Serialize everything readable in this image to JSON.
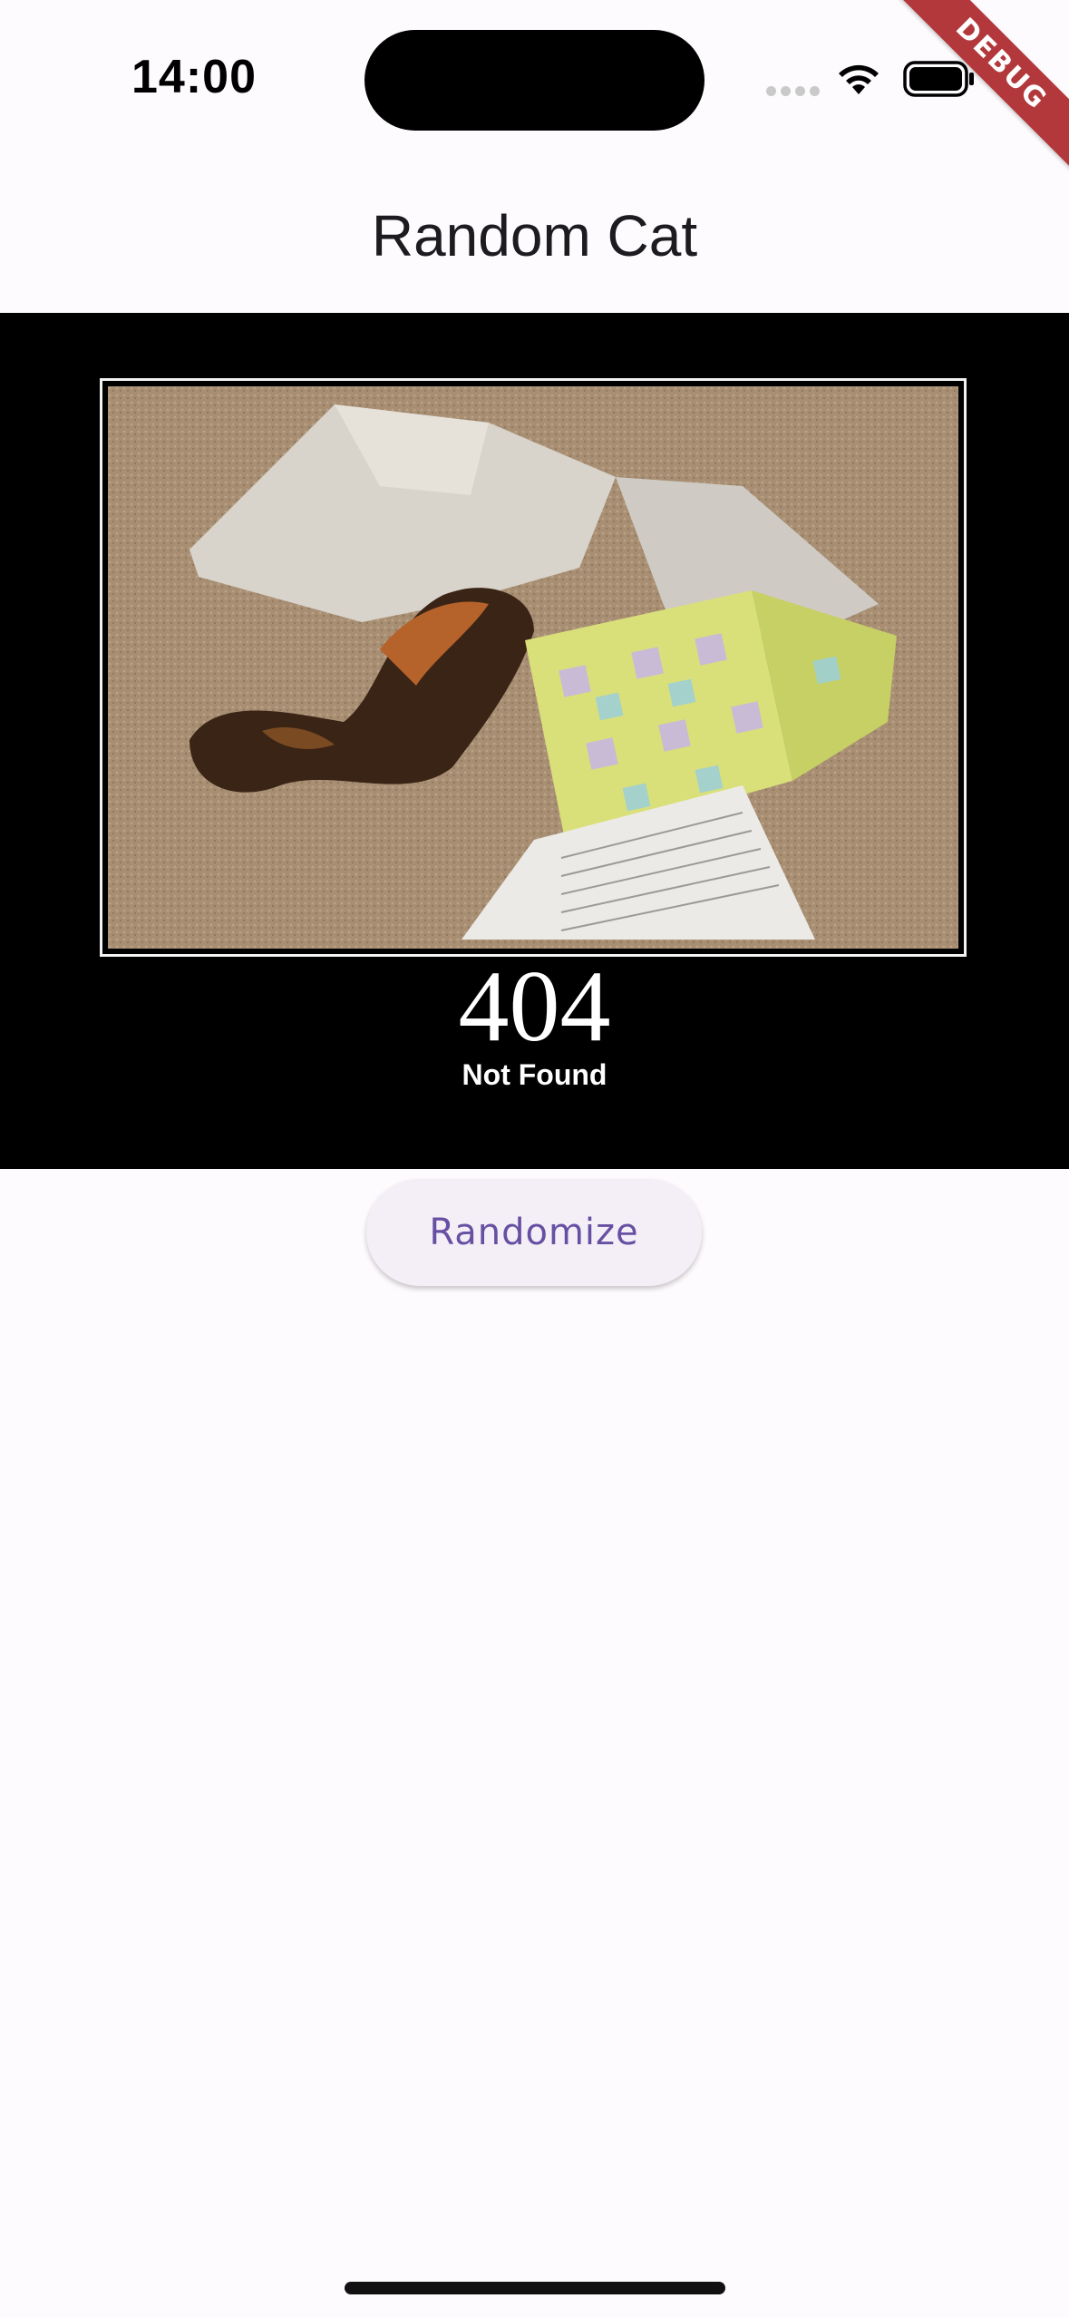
{
  "status_bar": {
    "time": "14:00",
    "icons": [
      "signal-dots-icon",
      "wifi-icon",
      "battery-icon"
    ]
  },
  "debug_banner": "DEBUG",
  "app_bar": {
    "title": "Random Cat"
  },
  "image": {
    "code": "404",
    "caption": "Not Found",
    "description_icon": "cat-photo"
  },
  "actions": {
    "randomize_label": "Randomize"
  },
  "colors": {
    "background": "#fefbfe",
    "accent": "#6750a4",
    "button_bg": "#f4eff6",
    "debug": "#b3383b"
  }
}
